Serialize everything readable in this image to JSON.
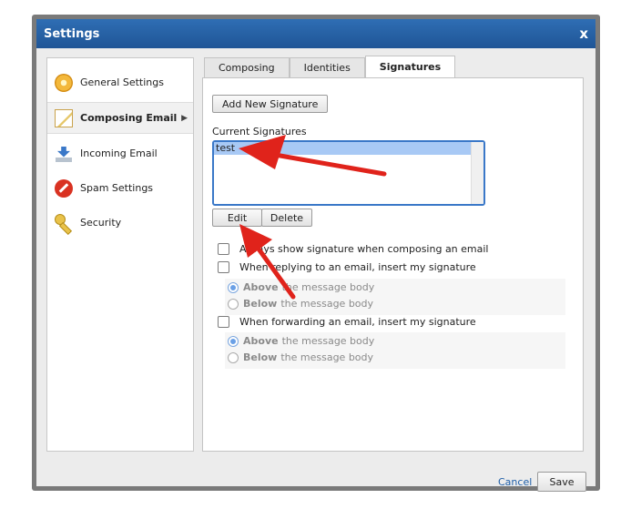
{
  "window": {
    "title": "Settings",
    "close": "x"
  },
  "sidebar": {
    "items": [
      {
        "label": "General Settings",
        "icon": "gear-icon"
      },
      {
        "label": "Composing Email",
        "icon": "compose-icon",
        "active": true,
        "chevron": "▶"
      },
      {
        "label": "Incoming Email",
        "icon": "incoming-icon"
      },
      {
        "label": "Spam Settings",
        "icon": "spam-icon"
      },
      {
        "label": "Security",
        "icon": "key-icon"
      }
    ]
  },
  "tabs": [
    {
      "label": "Composing"
    },
    {
      "label": "Identities"
    },
    {
      "label": "Signatures",
      "active": true
    }
  ],
  "signatures": {
    "add_label": "Add New Signature",
    "list_label": "Current Signatures",
    "items": [
      "test"
    ],
    "edit_label": "Edit",
    "delete_label": "Delete",
    "always_show": "Always show signature when composing an email",
    "reply_label": "When replying to an email, insert my signature",
    "reply_above_bold": "Above",
    "reply_above_rest": "the message body",
    "reply_below_bold": "Below",
    "reply_below_rest": "the message body",
    "forward_label": "When forwarding an email, insert my signature",
    "forward_above_bold": "Above",
    "forward_above_rest": "the message body",
    "forward_below_bold": "Below",
    "forward_below_rest": "the message body"
  },
  "footer": {
    "cancel_label": "Cancel",
    "save_label": "Save"
  },
  "colors": {
    "titlebar": "#1f5596",
    "selection": "#a8c9f5",
    "arrow": "#e0231b",
    "link": "#1e5ea8"
  }
}
